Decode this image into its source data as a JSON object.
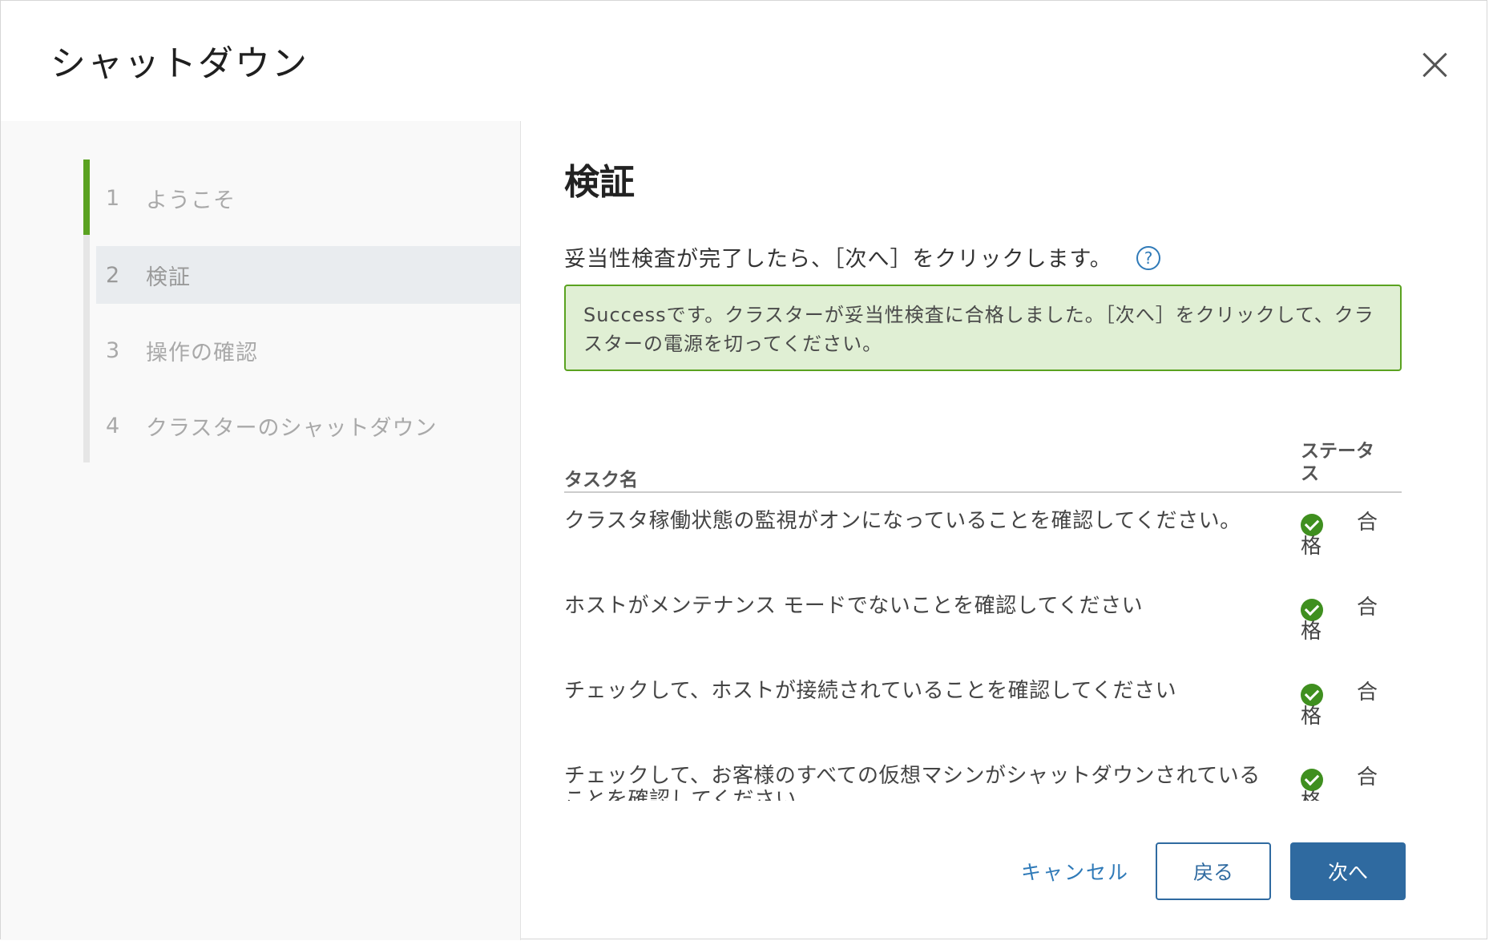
{
  "header": {
    "title": "シャットダウン",
    "close_icon": "close-icon"
  },
  "steps": [
    {
      "number": "1",
      "label": "ようこそ"
    },
    {
      "number": "2",
      "label": "検証"
    },
    {
      "number": "3",
      "label": "操作の確認"
    },
    {
      "number": "4",
      "label": "クラスターのシャットダウン"
    }
  ],
  "main": {
    "title": "検証",
    "instruction": "妥当性検査が完了したら、［次へ］をクリックします。",
    "help_icon": "?",
    "alert": "Successです。クラスターが妥当性検査に合格しました。［次へ］をクリックして、クラスターの電源を切ってください。",
    "table": {
      "columns": {
        "name": "タスク名",
        "status": "ステータス"
      },
      "rows": [
        {
          "name": "クラスタ稼働状態の監視がオンになっていることを確認してください。",
          "status": "合格"
        },
        {
          "name": "ホストがメンテナンス モードでないことを確認してください",
          "status": "合格"
        },
        {
          "name": "チェックして、ホストが接続されていることを確認してください",
          "status": "合格"
        },
        {
          "name": "チェックして、お客様のすべての仮想マシンがシャットダウンされていることを確認してください",
          "status": "合格"
        }
      ]
    }
  },
  "footer": {
    "cancel": "キャンセル",
    "back": "戻る",
    "next": "次へ"
  },
  "colors": {
    "accent": "#2f6aa0",
    "success_border": "#5aa220",
    "success_bg": "#e0efd4",
    "check": "#3f8f1f"
  }
}
